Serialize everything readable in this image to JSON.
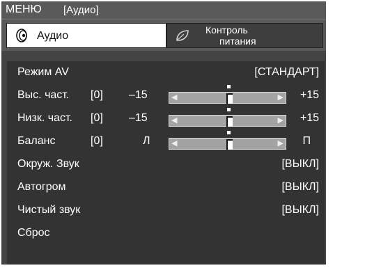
{
  "title": {
    "menu": "МЕНЮ",
    "section": "[Аудио]"
  },
  "tabs": [
    {
      "label": "Аудио",
      "icon": "speaker-icon",
      "selected": true
    },
    {
      "label_line1": "Контроль",
      "label_line2": "питания",
      "icon": "leaf-icon",
      "selected": false
    }
  ],
  "items": {
    "av_mode": {
      "label": "Режим AV",
      "value": "[СТАНДАРТ]"
    },
    "treble": {
      "label": "Выс. част.",
      "value": "[0]",
      "min": "–15",
      "max": "+15",
      "level": 0.5
    },
    "bass": {
      "label": "Низк. част.",
      "value": "[0]",
      "min": "–15",
      "max": "+15",
      "level": 0.5
    },
    "balance": {
      "label": "Баланс",
      "value": "[0]",
      "min": "Л",
      "max": "П",
      "level": 0.5
    },
    "surround": {
      "label": "Окруж. Звук",
      "value": "[ВЫКЛ]"
    },
    "auto_volume": {
      "label": "Автогром",
      "value": "[ВЫКЛ]"
    },
    "clear_voice": {
      "label": "Чистый звук",
      "value": "[ВЫКЛ]"
    },
    "reset": {
      "label": "Сброс"
    }
  }
}
